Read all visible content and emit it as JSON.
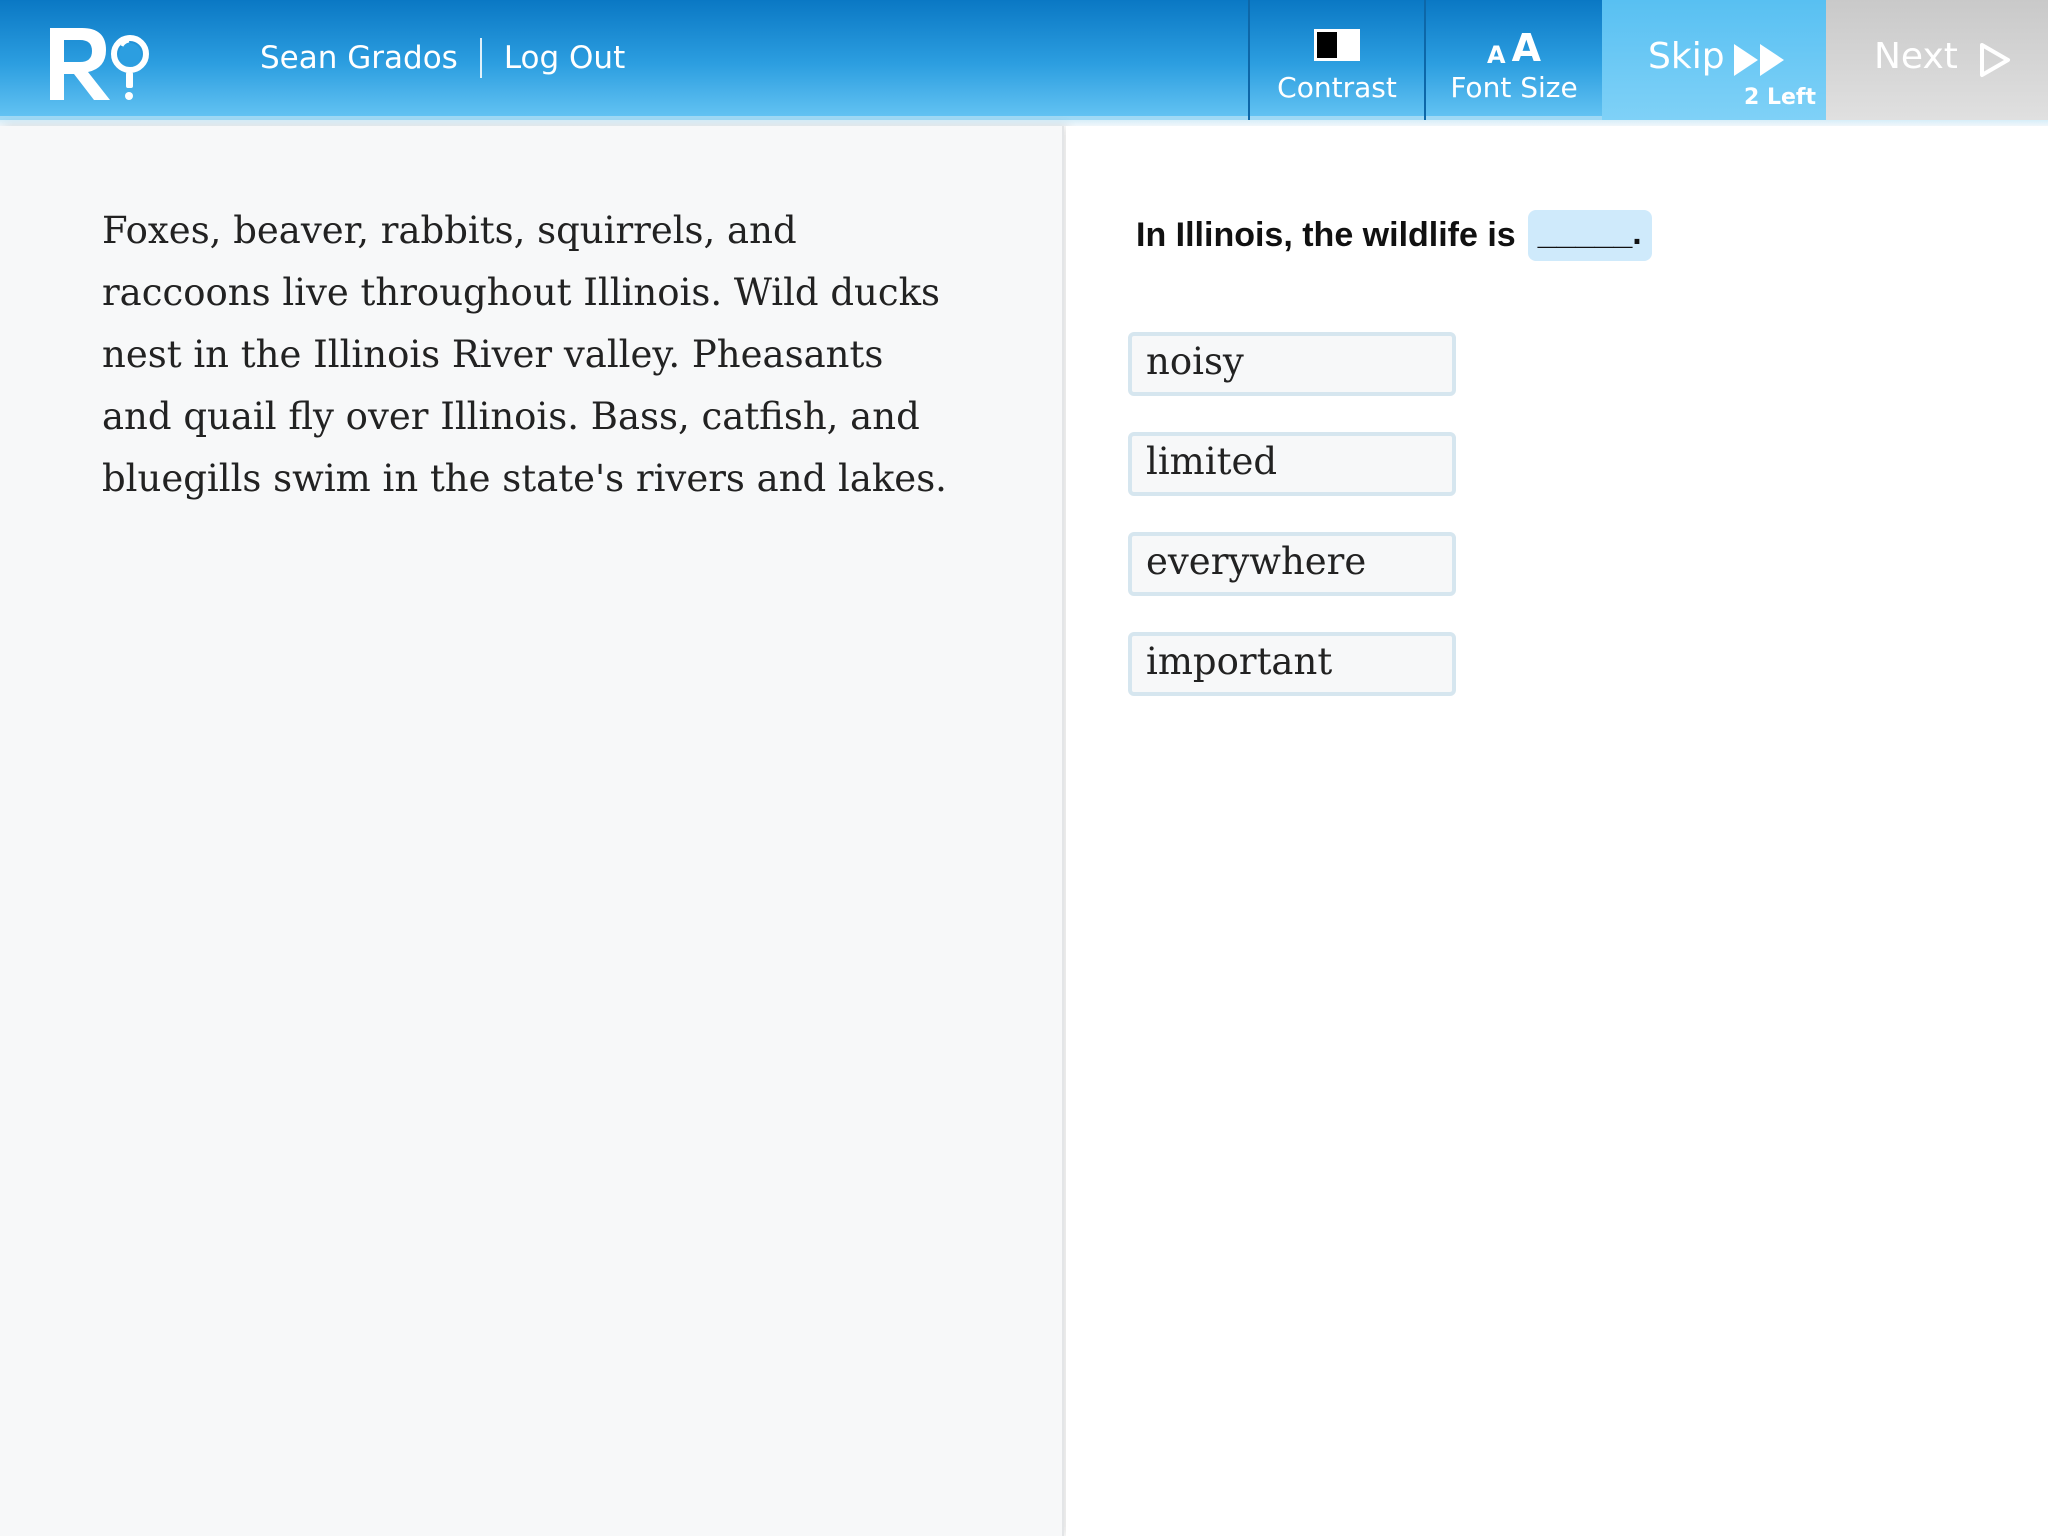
{
  "header": {
    "user_name": "Sean Grados",
    "logout_label": "Log Out",
    "contrast_label": "Contrast",
    "font_size_label": "Font Size",
    "font_icon_small": "A",
    "font_icon_big": "A",
    "skip_label": "Skip",
    "skip_count": "2 Left",
    "next_label": "Next"
  },
  "passage": {
    "text": "Foxes, beaver, rabbits, squirrels, and raccoons live throughout Illinois. Wild ducks nest in the Illinois River valley. Pheasants and quail fly over Illinois. Bass, catfish, and bluegills swim in the state's rivers and lakes."
  },
  "question": {
    "prompt": "In Illinois, the wildlife is",
    "blank": "_____.",
    "options": [
      "noisy",
      "limited",
      "everywhere",
      "important"
    ]
  },
  "colors": {
    "header_top": "#0a78c4",
    "header_bottom": "#62c2f2",
    "skip_bg": "#58c0f2",
    "next_bg": "#c9c9c9",
    "blank_bg": "#cfeafb",
    "option_border": "#d6e6ef"
  },
  "icons": {
    "logo": "r-magnifier-logo",
    "contrast": "contrast-icon",
    "font_size": "font-size-icon",
    "skip": "fast-forward-icon",
    "next": "play-arrow-icon"
  }
}
